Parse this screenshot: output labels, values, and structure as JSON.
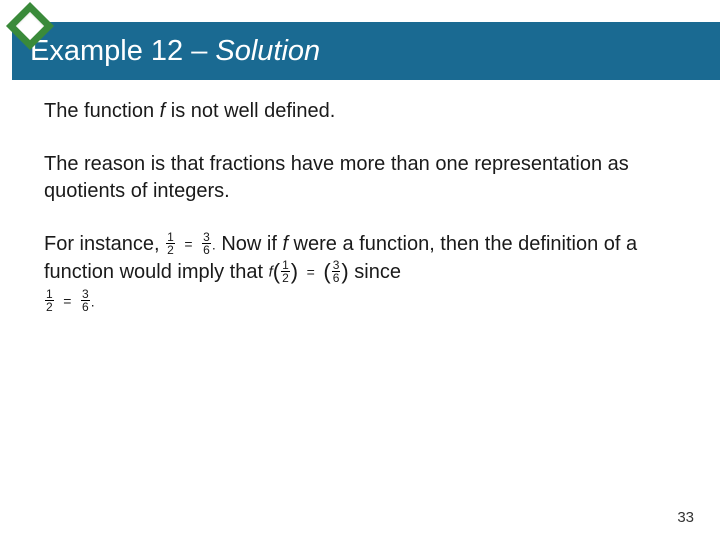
{
  "header": {
    "title_prefix": "Example 12 – ",
    "title_italic": "Solution"
  },
  "body": {
    "p1_a": "The function ",
    "p1_f": "f",
    "p1_b": " is not well defined.",
    "p2": "The reason is that fractions have more than one representation as quotients of integers.",
    "p3_a": "For instance, ",
    "p3_b": " Now if ",
    "p3_f": "f",
    "p3_c": " were a function, then the definition of a function would imply that ",
    "p3_d": " since"
  },
  "math": {
    "half_num": "1",
    "half_den": "2",
    "threesix_num": "3",
    "threesix_den": "6",
    "eq": "=",
    "period": ".",
    "f": "f"
  },
  "page": "33"
}
